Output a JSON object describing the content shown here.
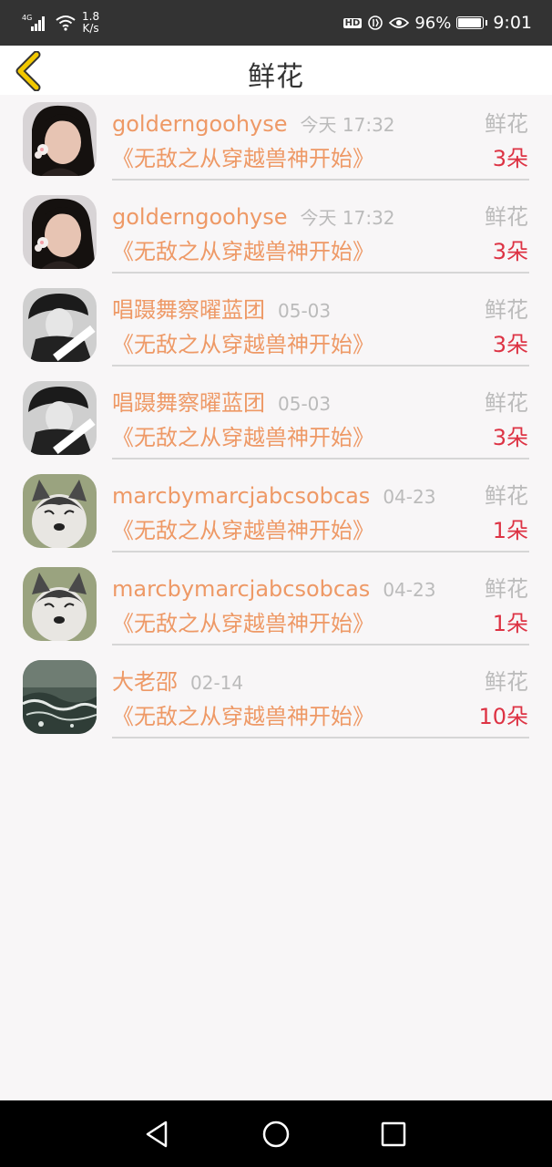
{
  "status_bar": {
    "network": "4G",
    "net_speed_value": "1.8",
    "net_speed_unit": "K/s",
    "hd": "HD",
    "battery_percent": "96%",
    "battery_level": 0.96,
    "time": "9:01",
    "icons": [
      "signal-icon",
      "wifi-icon",
      "hd-icon",
      "data-saver-icon",
      "eye-comfort-icon",
      "battery-icon"
    ]
  },
  "header": {
    "title": "鲜花",
    "back_icon": "chevron-left-icon",
    "accent_color": "#f2c800"
  },
  "records": [
    {
      "user": "golderngoohyse",
      "time": "今天 17:32",
      "type": "鲜花",
      "book": "《无敌之从穿越兽神开始》",
      "count": "3朵",
      "avatar": "girl-photo"
    },
    {
      "user": "golderngoohyse",
      "time": "今天 17:32",
      "type": "鲜花",
      "book": "《无敌之从穿越兽神开始》",
      "count": "3朵",
      "avatar": "girl-photo"
    },
    {
      "user": "唱蹑舞察曜蓝团",
      "time": "05-03",
      "type": "鲜花",
      "book": "《无敌之从穿越兽神开始》",
      "count": "3朵",
      "avatar": "bw-portrait"
    },
    {
      "user": "唱蹑舞察曜蓝团",
      "time": "05-03",
      "type": "鲜花",
      "book": "《无敌之从穿越兽神开始》",
      "count": "3朵",
      "avatar": "bw-portrait"
    },
    {
      "user": "marcbymarcjabcsobcas",
      "time": "04-23",
      "type": "鲜花",
      "book": "《无敌之从穿越兽神开始》",
      "count": "1朵",
      "avatar": "husky-dog"
    },
    {
      "user": "marcbymarcjabcsobcas",
      "time": "04-23",
      "type": "鲜花",
      "book": "《无敌之从穿越兽神开始》",
      "count": "1朵",
      "avatar": "husky-dog"
    },
    {
      "user": "大老邵",
      "time": "02-14",
      "type": "鲜花",
      "book": "《无敌之从穿越兽神开始》",
      "count": "10朵",
      "avatar": "waves-photo"
    }
  ],
  "colors": {
    "name": "#ee9966",
    "count": "#dd3344",
    "muted": "#bbbbbb",
    "background": "#f8f6f7"
  },
  "nav_bar": {
    "icons": [
      "back-triangle-icon",
      "home-circle-icon",
      "recents-square-icon"
    ]
  }
}
